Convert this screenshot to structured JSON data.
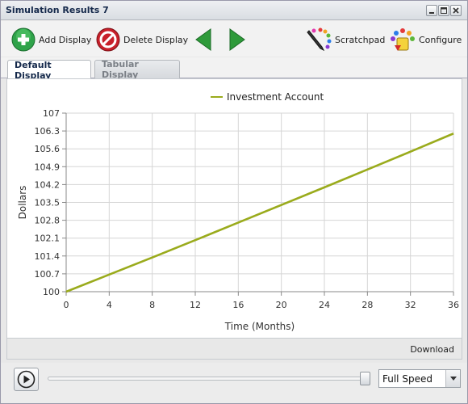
{
  "window": {
    "title": "Simulation Results 7"
  },
  "toolbar": {
    "add_label": "Add Display",
    "delete_label": "Delete Display",
    "scratchpad_label": "Scratchpad",
    "configure_label": "Configure"
  },
  "tabs": [
    {
      "label": "Default Display",
      "active": true
    },
    {
      "label": "Tabular Display",
      "active": false
    }
  ],
  "chart_data": {
    "type": "line",
    "title": "",
    "xlabel": "Time (Months)",
    "ylabel": "Dollars",
    "xlim": [
      0,
      36
    ],
    "ylim": [
      100,
      107
    ],
    "x_ticks": [
      "0",
      "4",
      "8",
      "12",
      "16",
      "20",
      "24",
      "28",
      "32",
      "36"
    ],
    "y_ticks": [
      "100",
      "100.7",
      "101.4",
      "102.1",
      "102.8",
      "103.5",
      "104.2",
      "104.9",
      "105.6",
      "106.3",
      "107"
    ],
    "grid": true,
    "legend_position": "top-center",
    "series": [
      {
        "name": "Investment Account",
        "color": "#9aab1c",
        "x": [
          0,
          4,
          8,
          12,
          16,
          20,
          24,
          28,
          32,
          36
        ],
        "y": [
          100,
          100.67,
          101.34,
          102.02,
          102.71,
          103.4,
          104.09,
          104.79,
          105.49,
          106.2
        ]
      }
    ]
  },
  "download_label": "Download",
  "controls": {
    "speed_value": "Full Speed",
    "slider_position": 1.0
  }
}
